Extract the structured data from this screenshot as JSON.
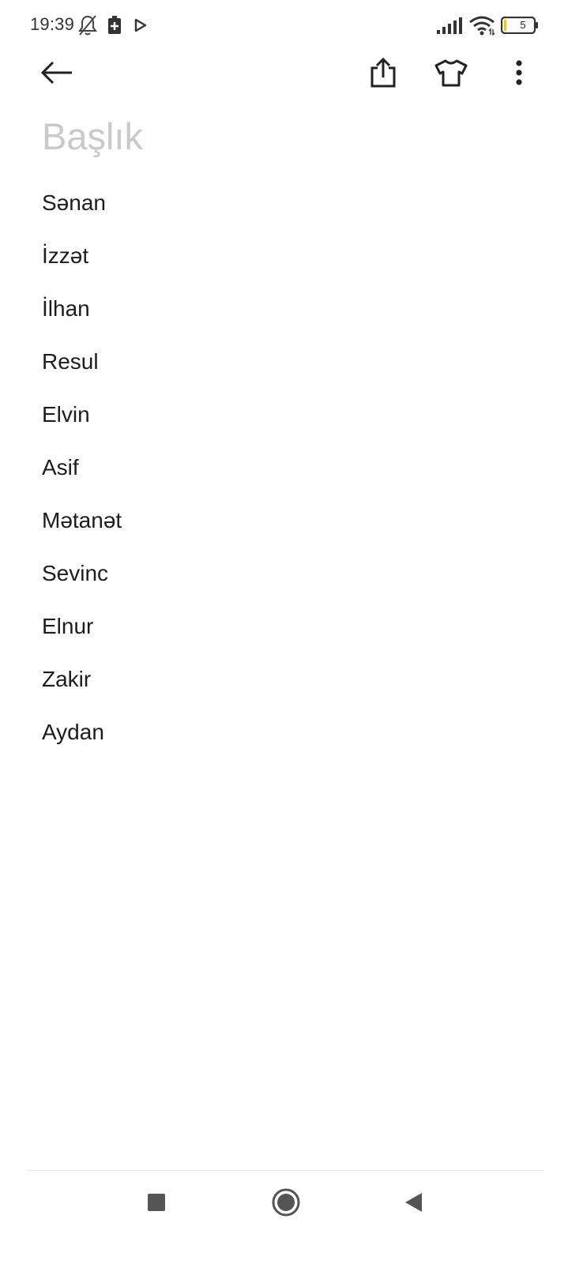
{
  "status_bar": {
    "time": "19:39",
    "battery_level": "5",
    "icons": [
      "bell-off-icon",
      "battery-saver-icon",
      "play-store-icon",
      "signal-icon",
      "wifi-icon",
      "battery-icon"
    ]
  },
  "toolbar": {
    "icons": [
      "back-arrow-icon",
      "share-icon",
      "theme-shirt-icon",
      "more-vert-icon"
    ]
  },
  "note": {
    "title_placeholder": "Başlık",
    "lines": [
      "Sənan",
      "İzzət",
      "İlhan",
      "Resul",
      "Elvin",
      "Asif",
      "Mətanət",
      "Sevinc",
      "Elnur",
      "Zakir",
      "Aydan"
    ]
  },
  "nav_bar": {
    "icons": [
      "recents-square-icon",
      "home-circle-icon",
      "back-triangle-icon"
    ]
  }
}
